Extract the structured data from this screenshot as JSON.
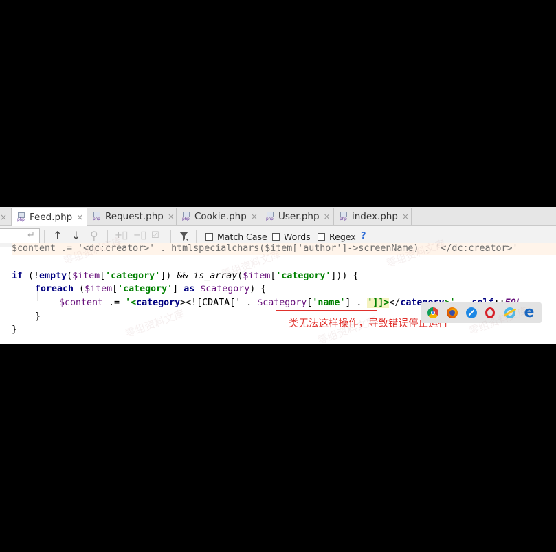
{
  "tabs": [
    {
      "label": "Feed.php",
      "active": true,
      "icon": "php-file-icon"
    },
    {
      "label": "Request.php",
      "active": false,
      "icon": "php-file-icon"
    },
    {
      "label": "Cookie.php",
      "active": false,
      "icon": "php-file-icon"
    },
    {
      "label": "User.php",
      "active": false,
      "icon": "php-file-icon"
    },
    {
      "label": "index.php",
      "active": false,
      "icon": "php-file-icon"
    }
  ],
  "file_icon_label": "php",
  "close_glyph": "×",
  "find_bar": {
    "search_value": "",
    "options": [
      {
        "label": "Match Case",
        "checked": false
      },
      {
        "label": "Words",
        "checked": false
      },
      {
        "label": "Regex",
        "checked": false
      }
    ],
    "help": "?"
  },
  "code": {
    "line0_cut": "$content .= '<dc:creator>' . htmlspecialchars($item['author']->screenName) . '</dc:creator>'",
    "line1": {
      "kw_if": "if",
      "p1": " (!",
      "kw_empty": "empty",
      "p2": "(",
      "var1": "$item",
      "p3": "[",
      "str1": "'category'",
      "p4": "]) && ",
      "fn": "is_array",
      "p5": "(",
      "var2": "$item",
      "p6": "[",
      "str2": "'category'",
      "p7": "])) {"
    },
    "line2": {
      "kw_foreach": "foreach",
      "p1": " (",
      "var1": "$item",
      "p2": "[",
      "str1": "'category'",
      "p3": "] ",
      "kw_as": "as",
      "p4": " ",
      "var2": "$category",
      "p5": ") {"
    },
    "line3": {
      "var1": "$content",
      "p1": " .= ",
      "s1": "'<",
      "s1b": "category",
      "s1c": "><![CDATA['",
      "p2": " . ",
      "var2": "$category",
      "p3": "[",
      "str1": "'name'",
      "p4": "] . ",
      "s2": "']]>",
      "s2b": "</",
      "s2c": "category",
      "s2d": ">'",
      "p5": " . ",
      "self": "self",
      "p6": "::",
      "const": "EOL"
    },
    "line4": "}",
    "line5": "}"
  },
  "annotation": "类无法这样操作，导致错误停止运行",
  "browser_icons": [
    "chrome-icon",
    "firefox-icon",
    "safari-icon",
    "opera-icon",
    "internet-explorer-icon",
    "edge-icon"
  ],
  "colors": {
    "annotation": "#e0312c",
    "keyword": "#000080",
    "string": "#008000",
    "variable": "#660e7a"
  }
}
